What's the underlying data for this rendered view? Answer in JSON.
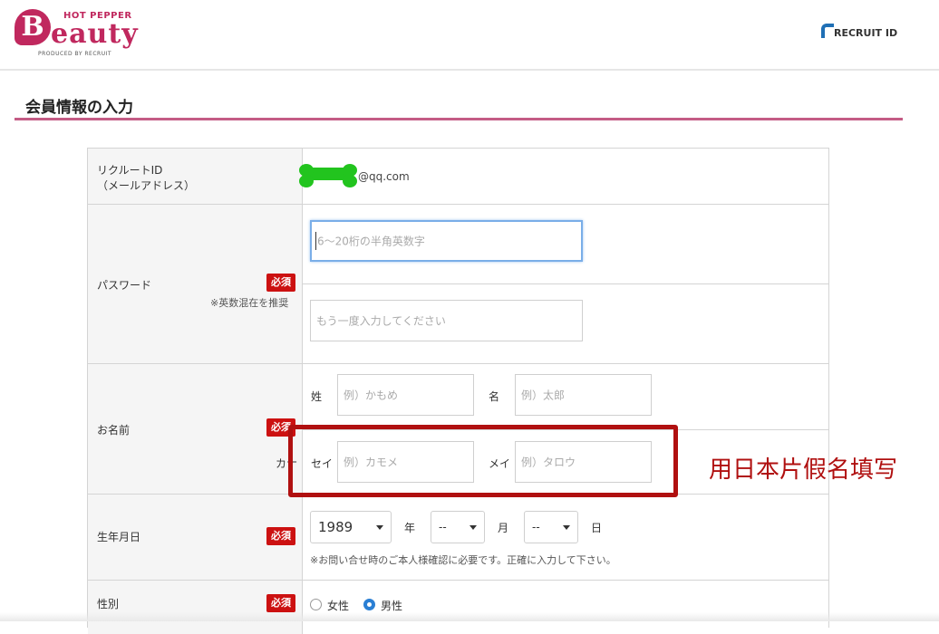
{
  "header": {
    "logo_letter": "B",
    "logo_small": "HOT PEPPER",
    "logo_brand": "eauty",
    "logo_produced": "PRODUCED BY RECRUIT",
    "recruit_id": "RECRUIT ID"
  },
  "page": {
    "title": "会員情報の入力"
  },
  "form": {
    "required_badge": "必須",
    "recruit_id": {
      "label_line1": "リクルートID",
      "label_line2": "（メールアドレス）",
      "value": "@qq.com"
    },
    "password": {
      "label": "パスワード",
      "note": "※英数混在を推奨",
      "placeholder": "6〜20桁の半角英数字",
      "confirm_placeholder": "もう一度入力してください"
    },
    "name": {
      "label": "お名前",
      "sei_label": "姓",
      "mei_label": "名",
      "sei_placeholder": "例）かもめ",
      "mei_placeholder": "例）太郎",
      "kana_label": "カナ",
      "sei_kana_label": "セイ",
      "mei_kana_label": "メイ",
      "sei_kana_placeholder": "例）カモメ",
      "mei_kana_placeholder": "例）タロウ"
    },
    "birthday": {
      "label": "生年月日",
      "year": "1989",
      "year_unit": "年",
      "month": "--",
      "month_unit": "月",
      "day": "--",
      "day_unit": "日",
      "note": "※お問い合せ時のご本人様確認に必要です。正確に入力して下さい。"
    },
    "gender": {
      "label": "性別",
      "female": "女性",
      "male": "男性"
    }
  },
  "annotation": {
    "text": "用日本片假名填写",
    "color": "#b01010"
  }
}
